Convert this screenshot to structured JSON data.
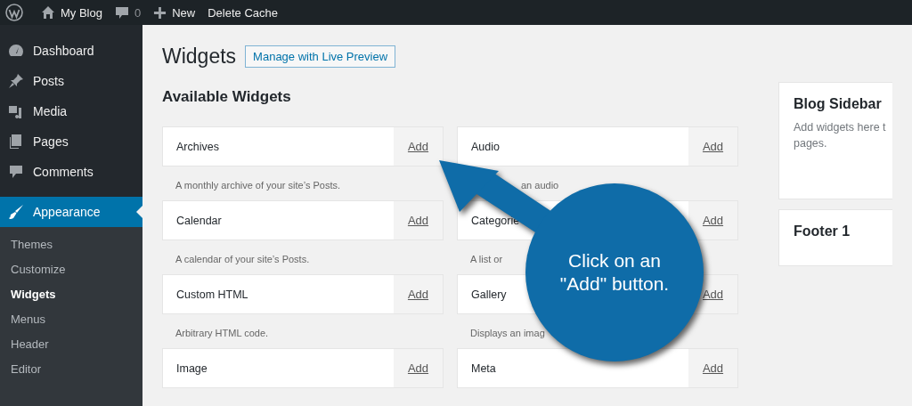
{
  "admin_bar": {
    "items": [
      {
        "kind": "logo"
      },
      {
        "kind": "home",
        "label": "My Blog"
      },
      {
        "kind": "comments",
        "label": "0"
      },
      {
        "kind": "new",
        "label": "New"
      },
      {
        "kind": "text",
        "label": "Delete Cache"
      }
    ]
  },
  "sidebar": {
    "items": [
      {
        "label": "Dashboard",
        "selected": false
      },
      {
        "label": "Posts",
        "selected": false
      },
      {
        "label": "Media",
        "selected": false
      },
      {
        "label": "Pages",
        "selected": false
      },
      {
        "label": "Comments",
        "selected": false
      },
      {
        "label": "Appearance",
        "selected": true,
        "children": [
          {
            "label": "Themes",
            "selected": false
          },
          {
            "label": "Customize",
            "selected": false
          },
          {
            "label": "Widgets",
            "selected": true
          },
          {
            "label": "Menus",
            "selected": false
          },
          {
            "label": "Header",
            "selected": false
          },
          {
            "label": "Editor",
            "selected": false
          }
        ]
      }
    ]
  },
  "page": {
    "title": "Widgets",
    "action": "Manage with Live Preview",
    "section": "Available Widgets",
    "widgets": [
      {
        "name": "Archives",
        "button": "Add",
        "description": "A monthly archive of your site’s Posts."
      },
      {
        "name": "Audio",
        "button": "Add",
        "description": "an audio"
      },
      {
        "name": "Calendar",
        "button": "Add",
        "description": "A calendar of your site’s Posts."
      },
      {
        "name": "Categorie",
        "button": "Add",
        "description": "A list or"
      },
      {
        "name": "Custom HTML",
        "button": "Add",
        "description": "Arbitrary HTML code."
      },
      {
        "name": "Gallery",
        "button": "Add",
        "description": "Displays an imag"
      },
      {
        "name": "Image",
        "button": "Add"
      },
      {
        "name": "Meta",
        "button": "Add"
      }
    ]
  },
  "widget_areas": [
    {
      "title": "Blog Sidebar",
      "lines": [
        "Add widgets here t",
        "pages."
      ]
    },
    {
      "title": "Footer 1"
    }
  ],
  "callout": {
    "text": "Click on an \"Add\" button."
  }
}
